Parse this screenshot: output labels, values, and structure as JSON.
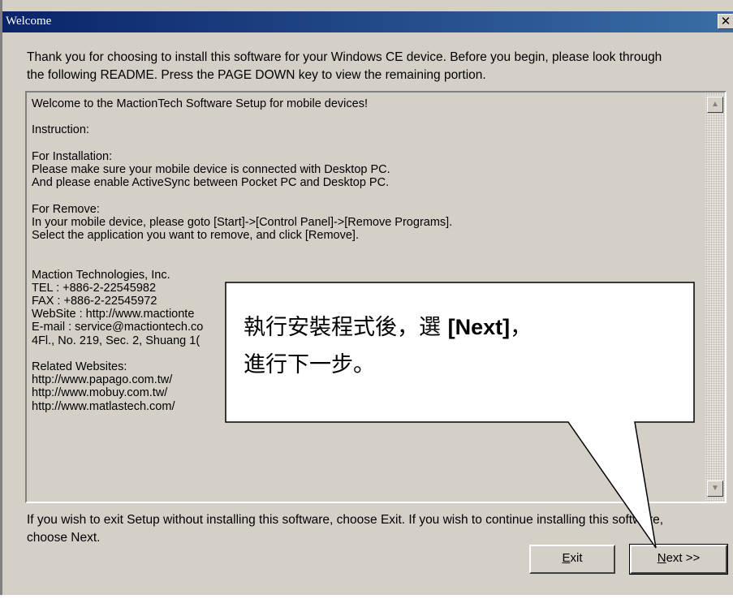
{
  "window": {
    "title": "Welcome",
    "close_glyph": "✕"
  },
  "intro": {
    "line1": "Thank you for choosing to install this software for your Windows CE device. Before you begin, please look through",
    "line2": "the following README. Press the PAGE DOWN key to view the remaining portion."
  },
  "readme": {
    "lines": [
      "Welcome to the MactionTech Software Setup for mobile devices!",
      "",
      "Instruction:",
      "",
      "For Installation:",
      "Please make sure your mobile device is connected with Desktop PC.",
      "And please enable ActiveSync between Pocket PC and Desktop PC.",
      "",
      "For Remove:",
      "In your mobile device, please goto [Start]->[Control Panel]->[Remove Programs].",
      "Select the application you want to remove, and click [Remove].",
      "",
      "",
      "Maction Technologies, Inc.",
      "TEL : +886-2-22545982",
      "FAX : +886-2-22545972",
      "WebSite : http://www.mactionte",
      "E-mail : service@mactiontech.co",
      "4Fl., No. 219, Sec. 2, Shuang 1(",
      "",
      "Related Websites:",
      "http://www.papago.com.tw/",
      "http://www.mobuy.com.tw/",
      "http://www.matlastech.com/"
    ],
    "scroll_up_glyph": "▲",
    "scroll_down_glyph": "▼"
  },
  "footer": {
    "line1": "If you wish to exit Setup without installing this software, choose Exit. If you wish to continue installing this software,",
    "line2": "choose Next."
  },
  "buttons": {
    "exit_mnemonic": "E",
    "exit_rest": "xit",
    "next_mnemonic": "N",
    "next_rest": "ext >>"
  },
  "callout": {
    "line1_pre": "執行安裝程式後，選 ",
    "line1_bold": "[Next]",
    "line1_post": "，",
    "line2": "進行下一步。"
  },
  "colors": {
    "titlebar_start": "#0a246a",
    "titlebar_end": "#3a6ea5",
    "face": "#d4d0c8"
  }
}
